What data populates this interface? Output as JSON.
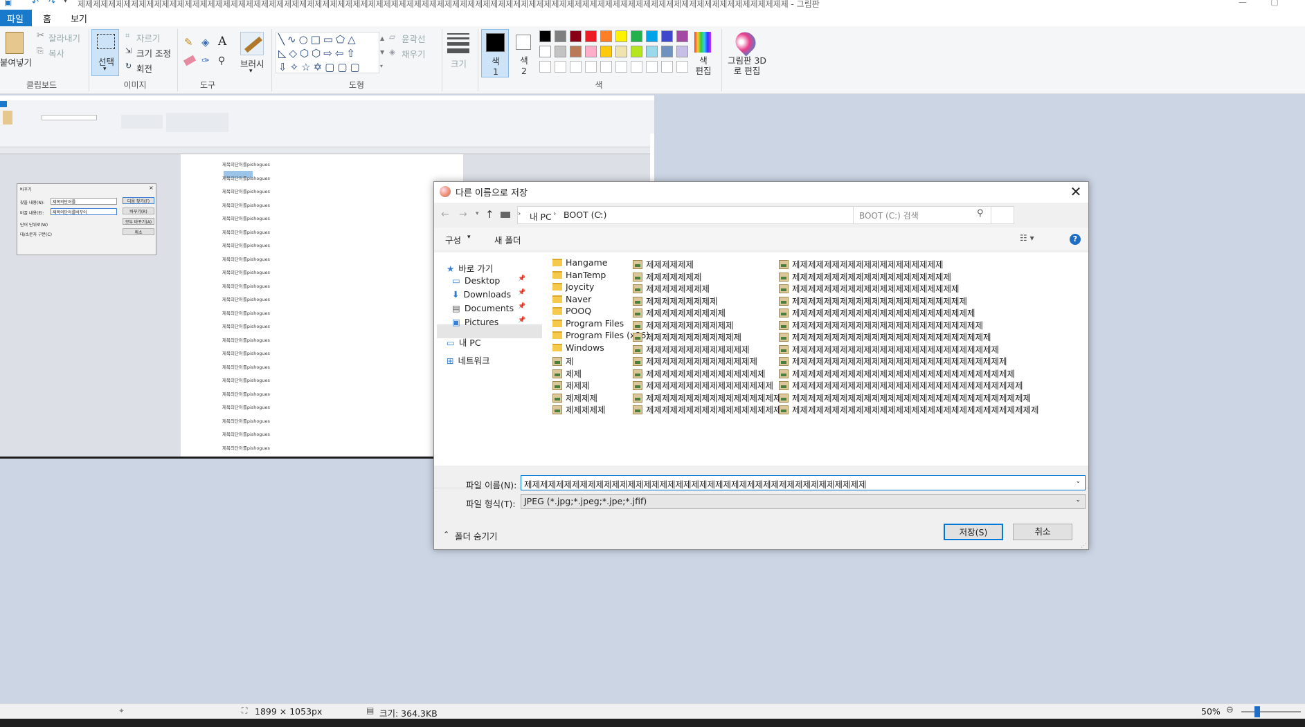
{
  "window": {
    "title": "제제제제제제제제제제제제제제제제제제제제제제제제제제제제제제제제제제제제제제제제제제제제제제제제제제제제제제제제제제제제제제제제제제제제제제제제제제제제제제제제제제제제제제제제제제제제제 - 그림판"
  },
  "menu": {
    "file": "파일",
    "home": "홈",
    "view": "보기"
  },
  "ribbon": {
    "clipboard": {
      "paste": "붙여넣기",
      "cut": "잘라내기",
      "copy": "복사",
      "label": "클립보드"
    },
    "image": {
      "select": "선택",
      "crop": "자르기",
      "resize": "크기 조정",
      "rotate": "회전",
      "label": "이미지"
    },
    "tools": {
      "label": "도구"
    },
    "brush": {
      "label": "브러시"
    },
    "shapes": {
      "outline": "윤곽선",
      "fill": "채우기",
      "label": "도형"
    },
    "size": {
      "label": "크기"
    },
    "colors": {
      "color1": "색 1",
      "color2": "색 2",
      "edit": "색 편집",
      "paint3d": "그림판 3D로 편집",
      "label": "색"
    },
    "palette": [
      "#000000",
      "#7f7f7f",
      "#880015",
      "#ed1c24",
      "#ff7f27",
      "#fff200",
      "#22b14c",
      "#00a2e8",
      "#3f48cc",
      "#a349a4",
      "#ffffff",
      "#c3c3c3",
      "#b97a57",
      "#ffaec9",
      "#ffc90e",
      "#efe4b0",
      "#b5e61d",
      "#99d9ea",
      "#7092be",
      "#c8bfe7"
    ]
  },
  "dialog": {
    "title": "다른 이름으로 저장",
    "close": "✕",
    "breadcrumb": [
      "내 PC",
      "BOOT (C:)"
    ],
    "search_placeholder": "BOOT (C:) 검색",
    "toolbar": {
      "organize": "구성",
      "new_folder": "새 폴더"
    },
    "nav": [
      {
        "label": "바로 가기"
      },
      {
        "label": "Desktop"
      },
      {
        "label": "Downloads"
      },
      {
        "label": "Documents"
      },
      {
        "label": "Pictures"
      },
      {
        "label": "내 PC"
      },
      {
        "label": "네트워크"
      }
    ],
    "col1": [
      "Hangame",
      "HanTemp",
      "Joycity",
      "Naver",
      "POOQ",
      "Program Files",
      "Program Files (x86)",
      "Windows",
      "제",
      "제제",
      "제제제",
      "제제제제",
      "제제제제제"
    ],
    "col2": [
      "제제제제제제",
      "제제제제제제제",
      "제제제제제제제제",
      "제제제제제제제제제",
      "제제제제제제제제제제",
      "제제제제제제제제제제제",
      "제제제제제제제제제제제제",
      "제제제제제제제제제제제제제",
      "제제제제제제제제제제제제제제",
      "제제제제제제제제제제제제제제제",
      "제제제제제제제제제제제제제제제제",
      "제제제제제제제제제제제제제제제제제",
      "제제제제제제제제제제제제제제제제제제"
    ],
    "col3": [
      "제제제제제제제제제제제제제제제제제제제",
      "제제제제제제제제제제제제제제제제제제제제",
      "제제제제제제제제제제제제제제제제제제제제제",
      "제제제제제제제제제제제제제제제제제제제제제제",
      "제제제제제제제제제제제제제제제제제제제제제제제",
      "제제제제제제제제제제제제제제제제제제제제제제제제",
      "제제제제제제제제제제제제제제제제제제제제제제제제제",
      "제제제제제제제제제제제제제제제제제제제제제제제제제제",
      "제제제제제제제제제제제제제제제제제제제제제제제제제제제",
      "제제제제제제제제제제제제제제제제제제제제제제제제제제제제",
      "제제제제제제제제제제제제제제제제제제제제제제제제제제제제제",
      "제제제제제제제제제제제제제제제제제제제제제제제제제제제제제제",
      "제제제제제제제제제제제제제제제제제제제제제제제제제제제제제제제"
    ],
    "filename_label": "파일 이름(N):",
    "filename_value": "제제제제제제제제제제제제제제제제제제제제제제제제제제제제제제제제제제제제제제제제제제제",
    "filetype_label": "파일 형식(T):",
    "filetype_value": "JPEG (*.jpg;*.jpeg;*.jpe;*.jfif)",
    "hide_folders": "폴더 숨기기",
    "save": "저장(S)",
    "cancel": "취소"
  },
  "screenshot": {
    "line_text": "제목의단어를pishogues",
    "find": {
      "title": "바꾸기",
      "find_label": "찾을 내용(N):",
      "replace_label": "바꿀 내용(E):",
      "find_value": "제목의단어를",
      "replace_value": "제목의단어를바꾸어",
      "next": "다음 찾기(F)",
      "replace": "바꾸기(R)",
      "replace_all": "모두 바꾸기(A)",
      "cancel": "취소",
      "opt1": "단어 단위로(W)",
      "opt2": "대/소문자 구분(C)"
    }
  },
  "status": {
    "dimensions": "1899 × 1053px",
    "size": "크기: 364.3KB",
    "zoom": "50%"
  }
}
